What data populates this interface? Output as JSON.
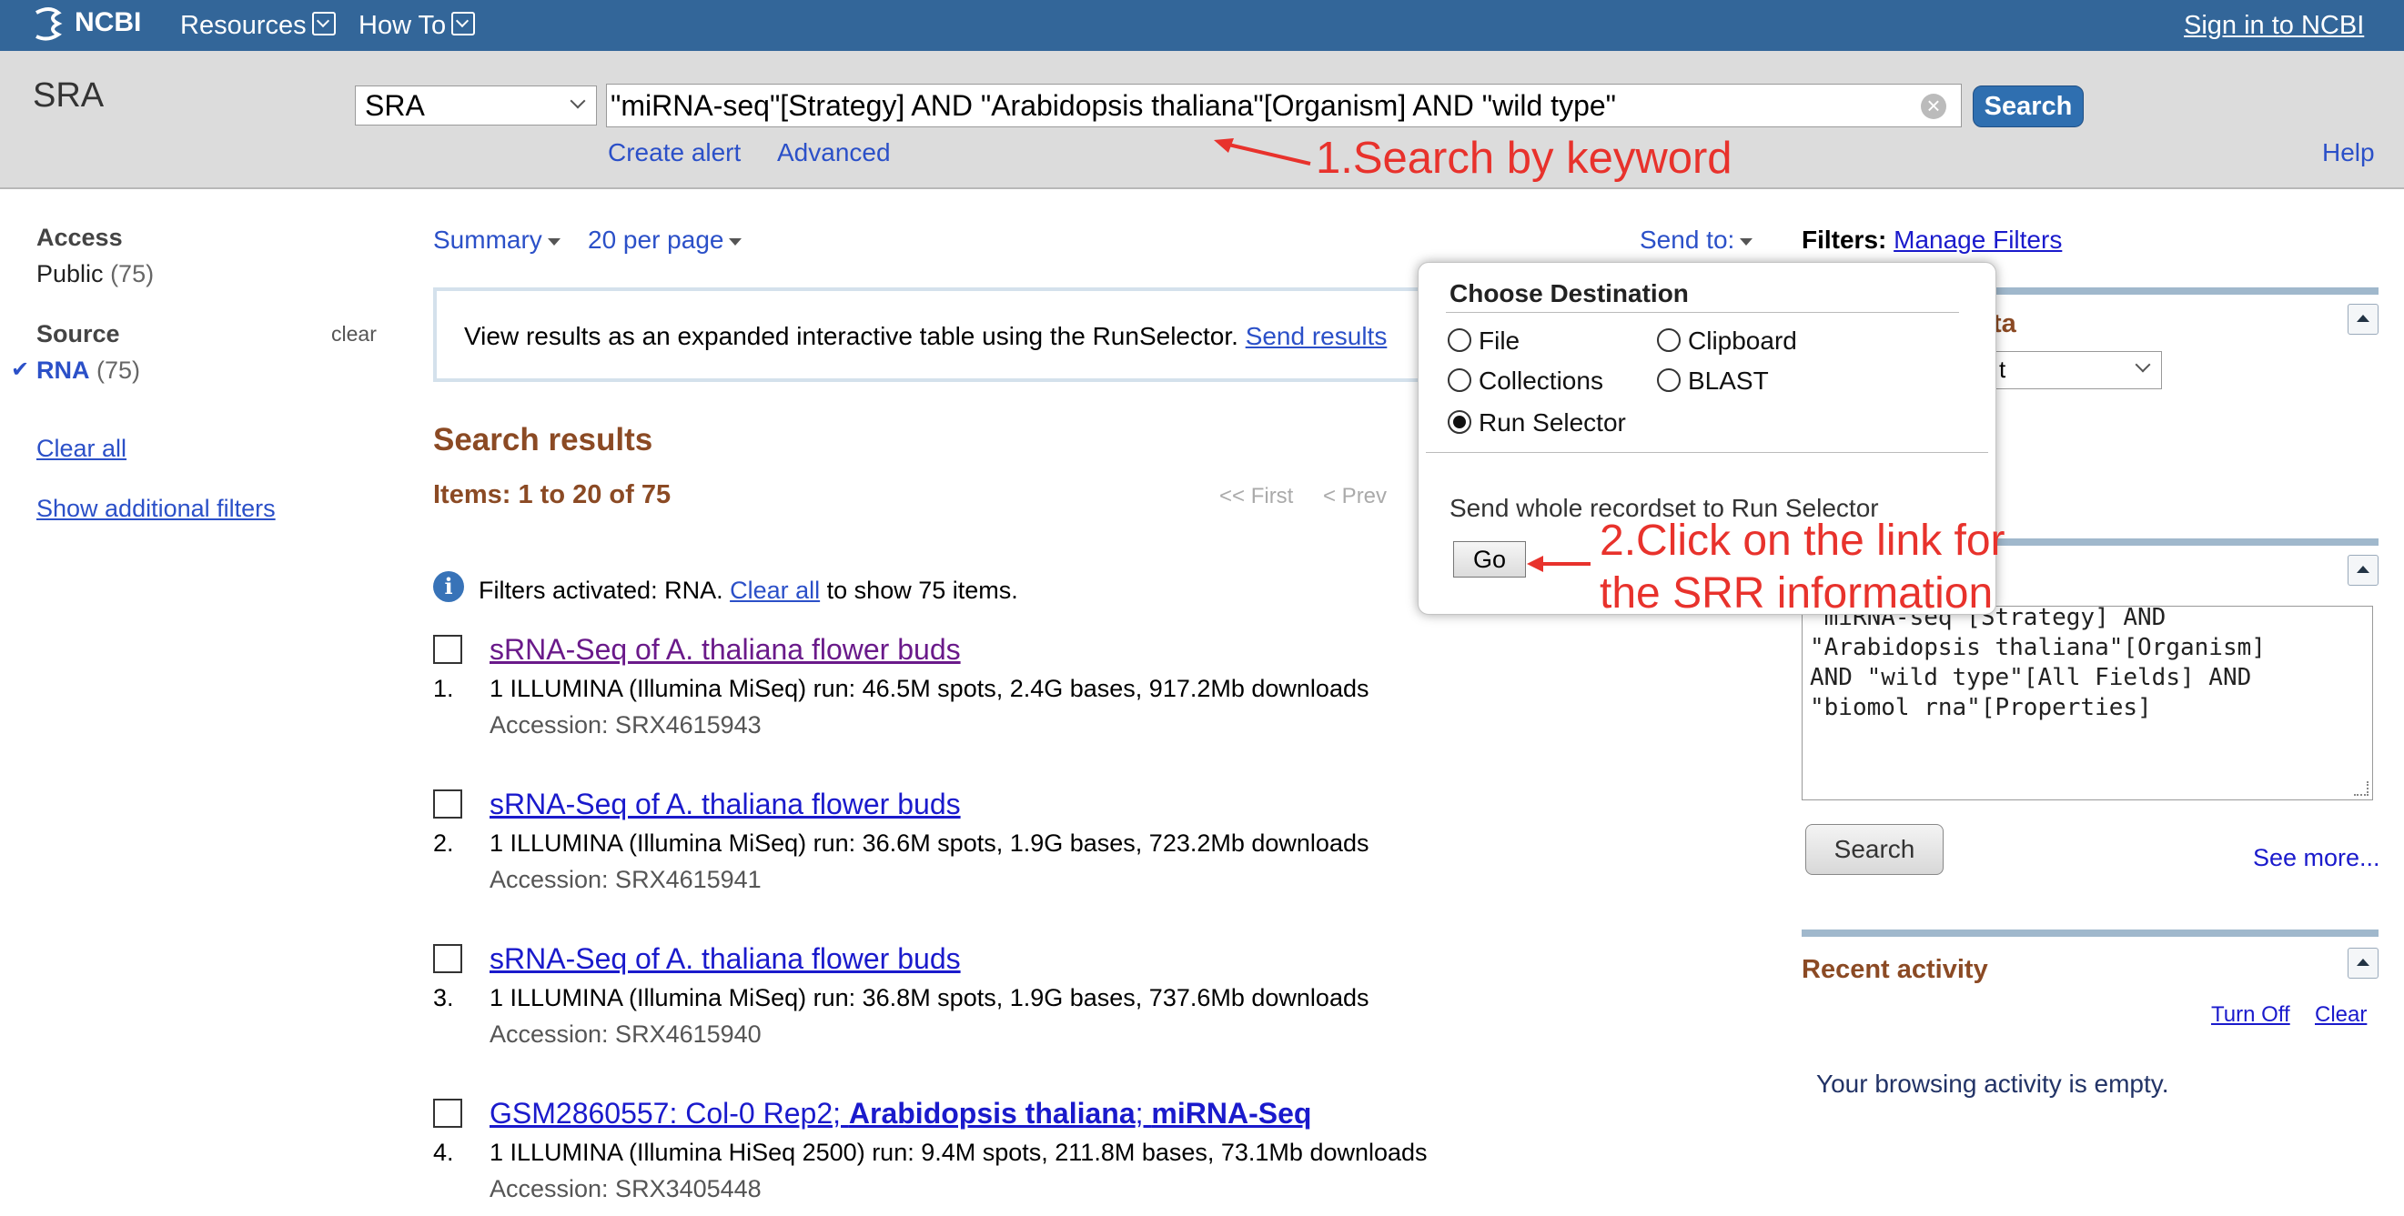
{
  "topbar": {
    "logo": "NCBI",
    "resources": "Resources",
    "howto": "How To",
    "signin": "Sign in to NCBI"
  },
  "search": {
    "db_label": "SRA",
    "db_select": "SRA",
    "query": "\"miRNA-seq\"[Strategy] AND \"Arabidopsis thaliana\"[Organism] AND \"wild type\"",
    "button": "Search",
    "create_alert": "Create alert",
    "advanced": "Advanced",
    "help": "Help"
  },
  "annotations": {
    "a1": "1.Search by keyword",
    "a2_line1": "2.Click on the link for",
    "a2_line2": "the SRR information"
  },
  "sidebar": {
    "access_heading": "Access",
    "public_label": "Public",
    "public_count": "(75)",
    "source_heading": "Source",
    "source_clear": "clear",
    "rna_label": "RNA",
    "rna_count": "(75)",
    "clear_all": "Clear all",
    "show_filters": "Show additional filters"
  },
  "toolbar": {
    "summary": "Summary",
    "per_page": "20 per page",
    "send_to": "Send to:",
    "filters_label": "Filters:",
    "manage_filters": "Manage Filters"
  },
  "banner": {
    "text": "View results as an expanded interactive table using the RunSelector.",
    "link": "Send results"
  },
  "results": {
    "heading": "Search results",
    "items_count": "Items: 1 to 20 of 75",
    "first": "<< First",
    "prev": "< Prev",
    "filters_text": "Filters activated: RNA.",
    "filters_link": "Clear all",
    "filters_suffix": "to show 75 items.",
    "items": [
      {
        "num": "1.",
        "title": "sRNA-Seq of A. thaliana flower buds",
        "desc": "1 ILLUMINA (Illumina MiSeq) run: 46.5M spots, 2.4G bases, 917.2Mb downloads",
        "accession": "Accession: SRX4615943"
      },
      {
        "num": "2.",
        "title": "sRNA-Seq of A. thaliana flower buds",
        "desc": "1 ILLUMINA (Illumina MiSeq) run: 36.6M spots, 1.9G bases, 723.2Mb downloads",
        "accession": "Accession: SRX4615941"
      },
      {
        "num": "3.",
        "title": "sRNA-Seq of A. thaliana flower buds",
        "desc": "1 ILLUMINA (Illumina MiSeq) run: 36.8M spots, 1.9G bases, 737.6Mb downloads",
        "accession": "Accession: SRX4615940"
      },
      {
        "num": "4.",
        "title_plain": "GSM2860557: Col-0 Rep2; ",
        "title_bold1": "Arabidopsis thaliana",
        "title_sep": "; ",
        "title_bold2": "miRNA-Seq",
        "desc": "1 ILLUMINA (Illumina HiSeq 2500) run: 9.4M spots, 211.8M bases, 73.1Mb downloads",
        "accession": "Accession: SRX3405448"
      }
    ]
  },
  "popup": {
    "title": "Choose Destination",
    "options": [
      "File",
      "Clipboard",
      "Collections",
      "BLAST",
      "Run Selector"
    ],
    "selected": "Run Selector",
    "send_text": "Send whole recordset to Run Selector",
    "go": "Go"
  },
  "right": {
    "partial_heading": "ta",
    "partial_select": "t",
    "query_box": "\"miRNA-seq\"[Strategy] AND \"Arabidopsis thaliana\"[Organism] AND \"wild type\"[All Fields] AND \"biomol rna\"[Properties]",
    "search_button": "Search",
    "see_more": "See more...",
    "recent_heading": "Recent activity",
    "turn_off": "Turn Off",
    "clear": "Clear",
    "recent_empty": "Your browsing activity is empty."
  },
  "colors": {
    "topbar": "#336699",
    "annotation": "#e8322c",
    "heading_brown": "#8b4a24",
    "link": "#2b50c8"
  }
}
